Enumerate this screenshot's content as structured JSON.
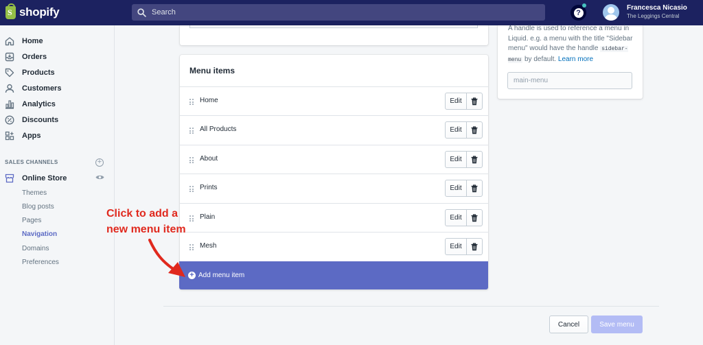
{
  "topbar": {
    "logo_text": "shopify",
    "search_placeholder": "Search",
    "help_glyph": "?",
    "user_name": "Francesca Nicasio",
    "store_name": "The Leggings Central"
  },
  "sidebar": {
    "items": [
      {
        "label": "Home",
        "icon": "home-icon"
      },
      {
        "label": "Orders",
        "icon": "orders-icon"
      },
      {
        "label": "Products",
        "icon": "tag-icon"
      },
      {
        "label": "Customers",
        "icon": "person-icon"
      },
      {
        "label": "Analytics",
        "icon": "bar-chart-icon"
      },
      {
        "label": "Discounts",
        "icon": "discount-icon"
      },
      {
        "label": "Apps",
        "icon": "apps-icon"
      }
    ],
    "channels_heading": "SALES CHANNELS",
    "online_store": "Online Store",
    "sub_items": [
      "Themes",
      "Blog posts",
      "Pages",
      "Navigation",
      "Domains",
      "Preferences"
    ],
    "active_sub_item": "Navigation"
  },
  "handle_card": {
    "hint_text_1": "A handle is used to reference a menu in Liquid. e.g. a menu with the title \"Sidebar menu\" would have the handle ",
    "hint_code": "sidebar-menu",
    "hint_text_2": " by default. ",
    "learn_more": "Learn more",
    "handle_value": "main-menu"
  },
  "menu_items": {
    "title": "Menu items",
    "rows": [
      {
        "label": "Home"
      },
      {
        "label": "All Products"
      },
      {
        "label": "About"
      },
      {
        "label": "Prints"
      },
      {
        "label": "Plain"
      },
      {
        "label": "Mesh"
      }
    ],
    "edit_label": "Edit",
    "add_label": "Add menu item"
  },
  "annotation": {
    "text": "Click to add a new menu item"
  },
  "footer": {
    "cancel_label": "Cancel",
    "save_label": "Save menu"
  },
  "colors": {
    "topbar": "#1c2260",
    "accent": "#5c6ac4",
    "annotation": "#e0291e",
    "save_disabled": "#b3bcf5"
  }
}
